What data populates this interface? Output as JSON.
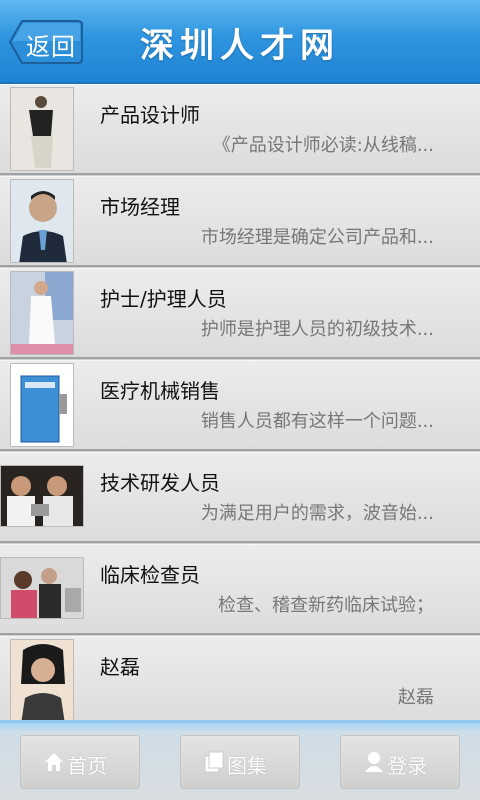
{
  "header": {
    "back_label": "返回",
    "title": "深圳人才网"
  },
  "list": [
    {
      "title": "产品设计师",
      "desc": "《产品设计师必读:从线稿..."
    },
    {
      "title": "市场经理",
      "desc": "市场经理是确定公司产品和..."
    },
    {
      "title": "护士/护理人员",
      "desc": "护师是护理人员的初级技术..."
    },
    {
      "title": "医疗机械销售",
      "desc": "销售人员都有这样一个问题..."
    },
    {
      "title": "技术研发人员",
      "desc": "为满足用户的需求，波音始..."
    },
    {
      "title": "临床检查员",
      "desc": "检查、稽查新药临床试验；"
    },
    {
      "title": "赵磊",
      "desc": "赵磊"
    }
  ],
  "tabbar": {
    "home": "首页",
    "gallery": "图集",
    "login": "登录"
  }
}
